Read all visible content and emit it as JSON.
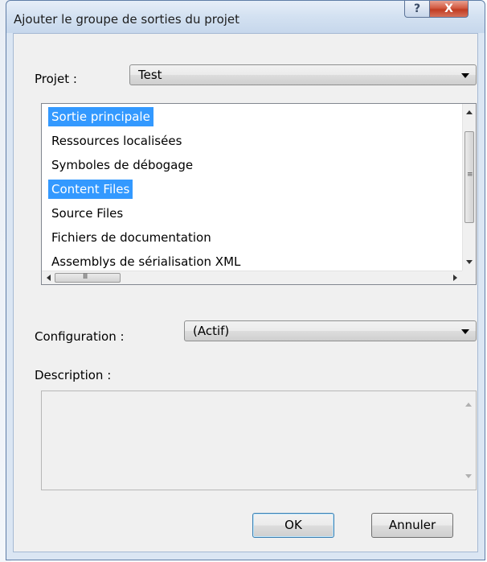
{
  "window": {
    "title": "Ajouter le groupe de sorties du projet",
    "help_glyph": "?",
    "close_glyph": "X"
  },
  "project": {
    "label": "Projet :",
    "value": "Test"
  },
  "outputs": {
    "items": [
      {
        "label": "Sortie principale",
        "selected": true
      },
      {
        "label": "Ressources localisées",
        "selected": false
      },
      {
        "label": "Symboles de débogage",
        "selected": false
      },
      {
        "label": "Content Files",
        "selected": true
      },
      {
        "label": "Source Files",
        "selected": false
      },
      {
        "label": "Fichiers de documentation",
        "selected": false
      },
      {
        "label": "Assemblys de sérialisation XML",
        "selected": false
      }
    ]
  },
  "configuration": {
    "label": "Configuration :",
    "value": "(Actif)"
  },
  "description": {
    "label": "Description :",
    "text": ""
  },
  "buttons": {
    "ok": "OK",
    "cancel": "Annuler"
  },
  "colors": {
    "selection": "#3399ff",
    "close_button": "#c13c22",
    "window_frame": "#dbe6f3"
  }
}
